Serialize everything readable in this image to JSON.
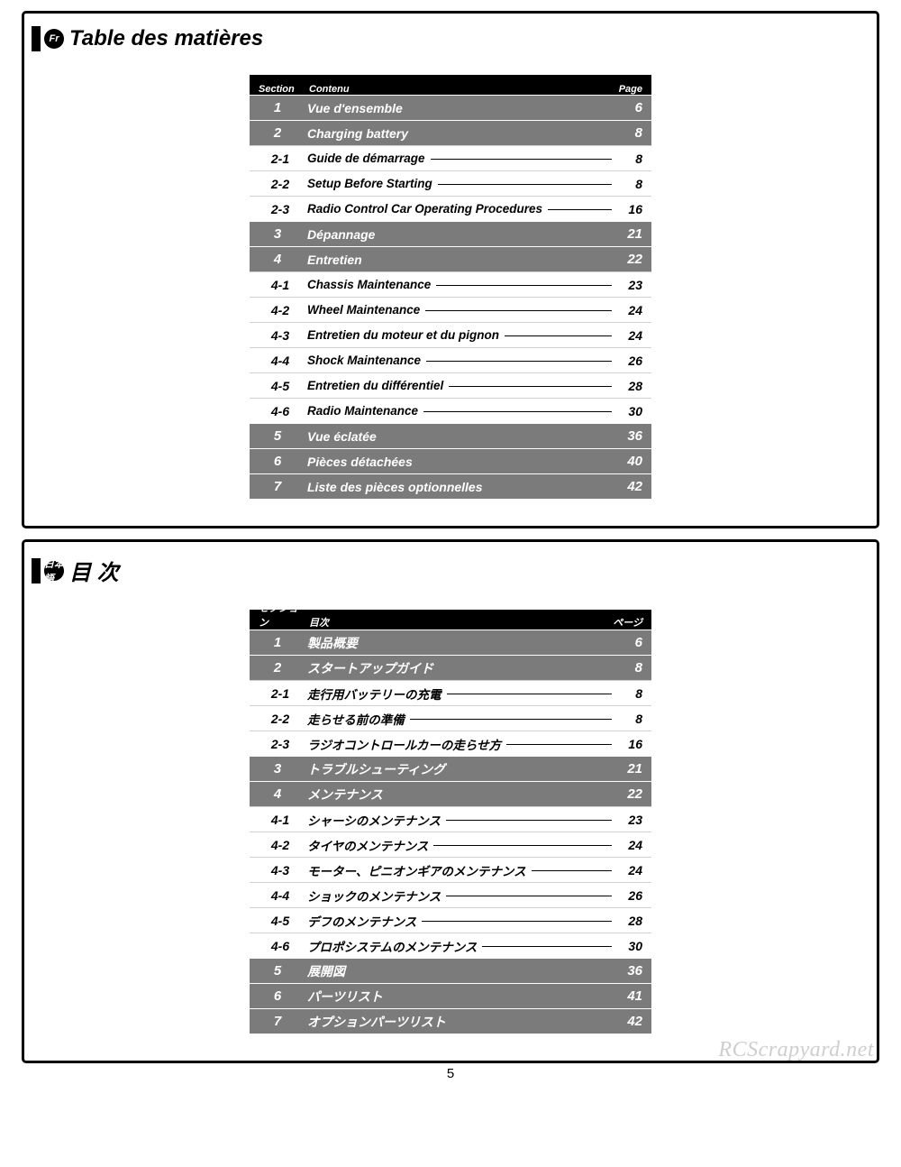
{
  "watermark": "RCScrapyard.net",
  "page_number": "5",
  "panels": [
    {
      "lang_badge": "Fr",
      "title": "Table des matières",
      "headers": {
        "section": "Section",
        "content": "Contenu",
        "page": "Page"
      },
      "rows": [
        {
          "t": "s",
          "sec": "1",
          "label": "Vue d'ensemble",
          "page": "6"
        },
        {
          "t": "s",
          "sec": "2",
          "label": "Charging battery",
          "page": "8"
        },
        {
          "t": "u",
          "sec": "2-1",
          "label": "Guide de démarrage",
          "page": "8"
        },
        {
          "t": "u",
          "sec": "2-2",
          "label": "Setup Before Starting",
          "page": "8"
        },
        {
          "t": "u",
          "sec": "2-3",
          "label": "Radio Control Car Operating Procedures",
          "page": "16"
        },
        {
          "t": "s",
          "sec": "3",
          "label": "Dépannage",
          "page": "21"
        },
        {
          "t": "s",
          "sec": "4",
          "label": "Entretien",
          "page": "22"
        },
        {
          "t": "u",
          "sec": "4-1",
          "label": "Chassis Maintenance",
          "page": "23"
        },
        {
          "t": "u",
          "sec": "4-2",
          "label": "Wheel Maintenance",
          "page": "24"
        },
        {
          "t": "u",
          "sec": "4-3",
          "label": "Entretien du moteur et du pignon",
          "page": "24"
        },
        {
          "t": "u",
          "sec": "4-4",
          "label": "Shock Maintenance",
          "page": "26"
        },
        {
          "t": "u",
          "sec": "4-5",
          "label": "Entretien du différentiel",
          "page": "28"
        },
        {
          "t": "u",
          "sec": "4-6",
          "label": "Radio Maintenance",
          "page": "30"
        },
        {
          "t": "s",
          "sec": "5",
          "label": "Vue éclatée",
          "page": "36"
        },
        {
          "t": "s",
          "sec": "6",
          "label": "Pièces détachées",
          "page": "40"
        },
        {
          "t": "s",
          "sec": "7",
          "label": "Liste des pièces optionnelles",
          "page": "42"
        }
      ]
    },
    {
      "lang_badge": "日本語",
      "title": "目 次",
      "headers": {
        "section": "セクション",
        "content": "目次",
        "page": "ページ"
      },
      "rows": [
        {
          "t": "s",
          "sec": "1",
          "label": "製品概要",
          "page": "6"
        },
        {
          "t": "s",
          "sec": "2",
          "label": "スタートアップガイド",
          "page": "8"
        },
        {
          "t": "u",
          "sec": "2-1",
          "label": "走行用バッテリーの充電",
          "page": "8"
        },
        {
          "t": "u",
          "sec": "2-2",
          "label": "走らせる前の準備",
          "page": "8"
        },
        {
          "t": "u",
          "sec": "2-3",
          "label": "ラジオコントロールカーの走らせ方",
          "page": "16"
        },
        {
          "t": "s",
          "sec": "3",
          "label": "トラブルシューティング",
          "page": "21"
        },
        {
          "t": "s",
          "sec": "4",
          "label": "メンテナンス",
          "page": "22"
        },
        {
          "t": "u",
          "sec": "4-1",
          "label": "シャーシのメンテナンス",
          "page": "23"
        },
        {
          "t": "u",
          "sec": "4-2",
          "label": "タイヤのメンテナンス",
          "page": "24"
        },
        {
          "t": "u",
          "sec": "4-3",
          "label": "モーター、ピニオンギアのメンテナンス",
          "page": "24"
        },
        {
          "t": "u",
          "sec": "4-4",
          "label": "ショックのメンテナンス",
          "page": "26"
        },
        {
          "t": "u",
          "sec": "4-5",
          "label": "デフのメンテナンス",
          "page": "28"
        },
        {
          "t": "u",
          "sec": "4-6",
          "label": "プロポシステムのメンテナンス",
          "page": "30"
        },
        {
          "t": "s",
          "sec": "5",
          "label": "展開図",
          "page": "36"
        },
        {
          "t": "s",
          "sec": "6",
          "label": "パーツリスト",
          "page": "41"
        },
        {
          "t": "s",
          "sec": "7",
          "label": "オプションパーツリスト",
          "page": "42"
        }
      ]
    }
  ]
}
